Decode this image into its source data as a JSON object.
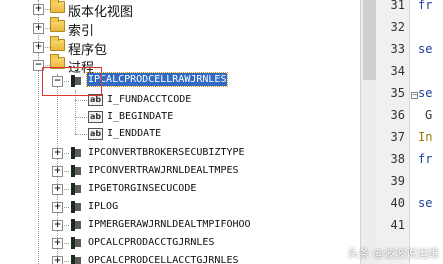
{
  "tree": {
    "top_nodes": [
      {
        "label": "版本化视图"
      },
      {
        "label": "索引"
      },
      {
        "label": "程序包"
      },
      {
        "label": "过程"
      }
    ],
    "selected_procedure": "IPCALCPRODCELLRAWJRNLES",
    "arguments": [
      "I_FUNDACCTCODE",
      "I_BEGINDATE",
      "I_ENDDATE"
    ],
    "procedures": [
      "IPCONVERTBROKERSECUBIZTYPE",
      "IPCONVERTRAWJRNLDEALTMPES",
      "IPGETORGINSECUCODE",
      "IPLOG",
      "IPMERGERAWJRNLDEALTMPIFOHOO",
      "OPCALCPRODACCTGJRNLES",
      "OPCALCPRODCELLACCTGJRNLES"
    ]
  },
  "editor": {
    "lines": [
      {
        "num": "31",
        "code": "fr",
        "color": "#1f3f9f"
      },
      {
        "num": "32",
        "code": "",
        "color": "#1f3f9f"
      },
      {
        "num": "33",
        "code": "se",
        "color": "#1f3f9f"
      },
      {
        "num": "34",
        "code": "",
        "color": "#1f3f9f"
      },
      {
        "num": "35",
        "code": "se",
        "color": "#1f3f9f"
      },
      {
        "num": "36",
        "code": "G",
        "color": "#333333"
      },
      {
        "num": "37",
        "code": "In",
        "color": "#9a7b00"
      },
      {
        "num": "38",
        "code": "fr",
        "color": "#1f3f9f"
      },
      {
        "num": "39",
        "code": "",
        "color": "#1f3f9f"
      },
      {
        "num": "40",
        "code": "se",
        "color": "#1f3f9f"
      },
      {
        "num": "41",
        "code": "",
        "color": "#1f3f9f"
      }
    ]
  },
  "watermark": "头条 @波波说运维"
}
